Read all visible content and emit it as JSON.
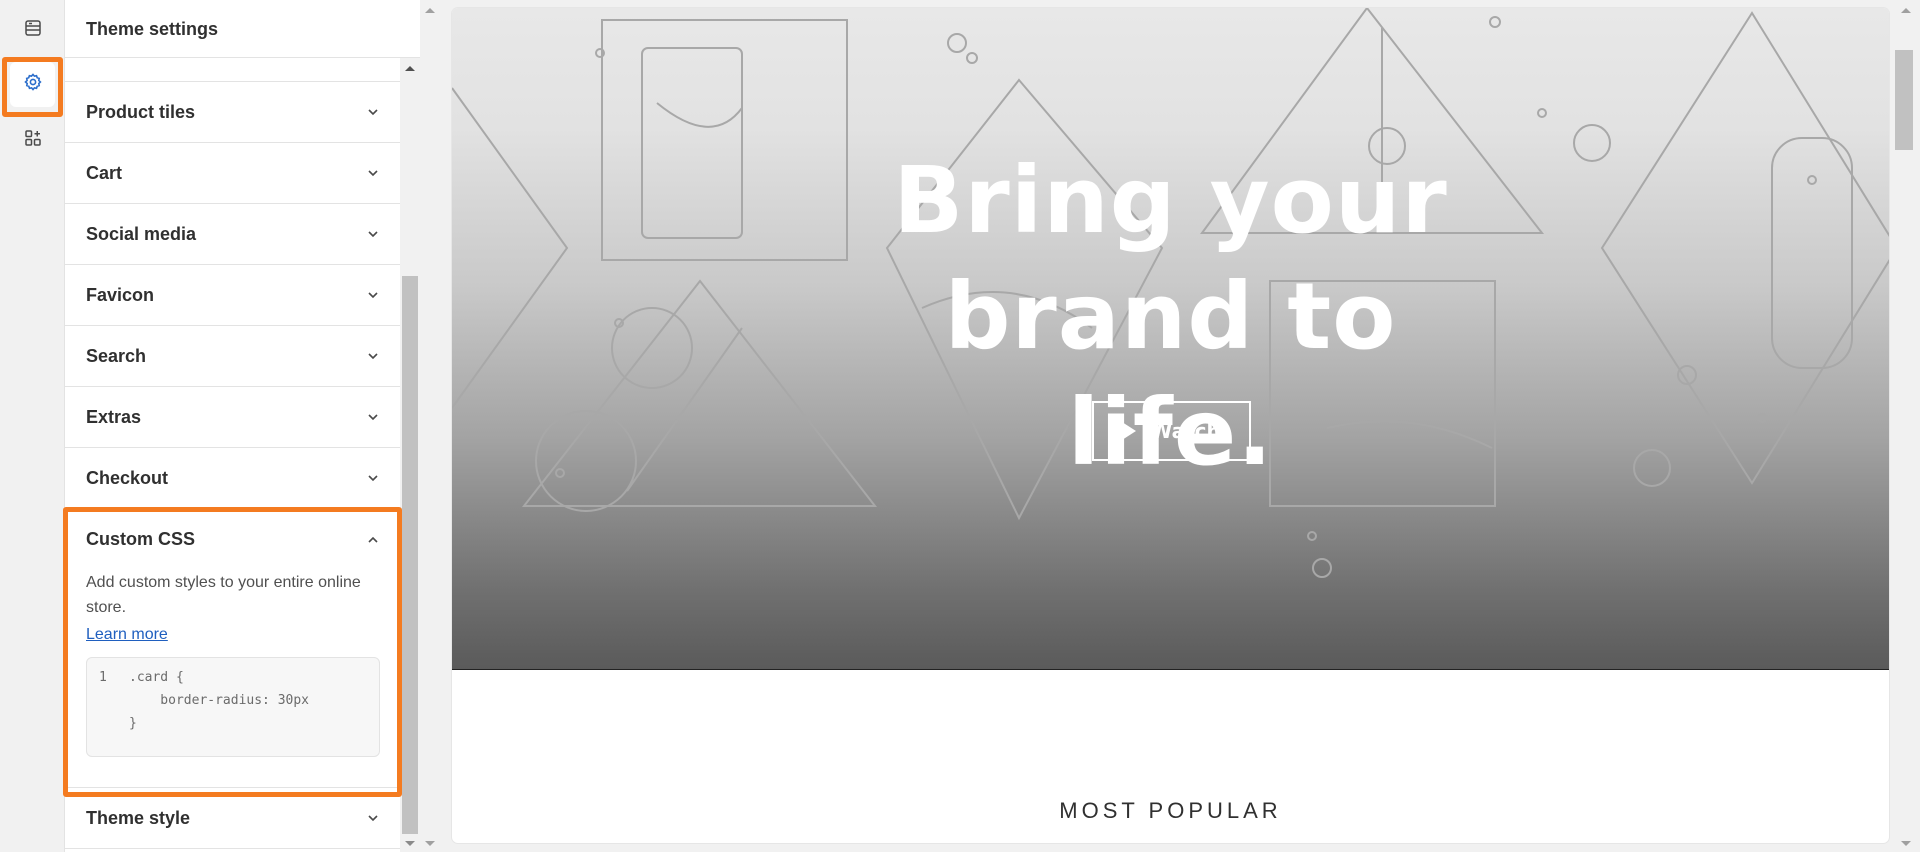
{
  "rail": {
    "items": [
      {
        "name": "sections",
        "icon": "sections-icon"
      },
      {
        "name": "theme-settings",
        "icon": "gear-icon",
        "active": true
      },
      {
        "name": "apps",
        "icon": "apps-add-icon"
      }
    ]
  },
  "panel": {
    "title": "Theme settings",
    "sections": [
      {
        "label": "Product tiles"
      },
      {
        "label": "Cart"
      },
      {
        "label": "Social media"
      },
      {
        "label": "Favicon"
      },
      {
        "label": "Search"
      },
      {
        "label": "Extras"
      },
      {
        "label": "Checkout"
      }
    ],
    "custom_css": {
      "label": "Custom CSS",
      "description": "Add custom styles to your entire online store.",
      "link": "Learn more",
      "code": {
        "line_number": "1",
        "lines": [
          ".card {",
          "    border-radius: 30px",
          "}"
        ]
      }
    },
    "after_sections": [
      {
        "label": "Theme style"
      }
    ]
  },
  "preview": {
    "hero_title": "Bring your brand to life.",
    "watch_label": "Watch",
    "section_heading": "MOST POPULAR"
  },
  "colors": {
    "highlight": "#f47b20",
    "link": "#1f5fbf",
    "active_icon": "#2c6ecb"
  }
}
